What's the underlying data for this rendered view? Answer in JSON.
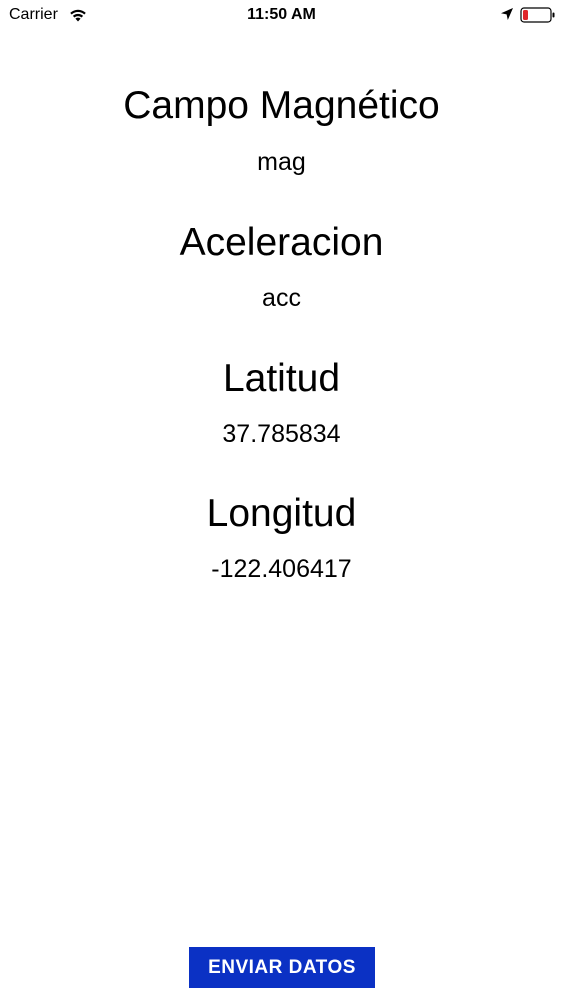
{
  "status_bar": {
    "carrier": "Carrier",
    "time": "11:50 AM",
    "battery_color": "#e0262b"
  },
  "fields": {
    "magnetic": {
      "label": "Campo Magnético",
      "value": "mag"
    },
    "acceleration": {
      "label": "Aceleracion",
      "value": "acc"
    },
    "latitude": {
      "label": "Latitud",
      "value": "37.785834"
    },
    "longitude": {
      "label": "Longitud",
      "value": "-122.406417"
    }
  },
  "actions": {
    "send_label": "ENVIAR DATOS",
    "send_color": "#0b31c4"
  }
}
